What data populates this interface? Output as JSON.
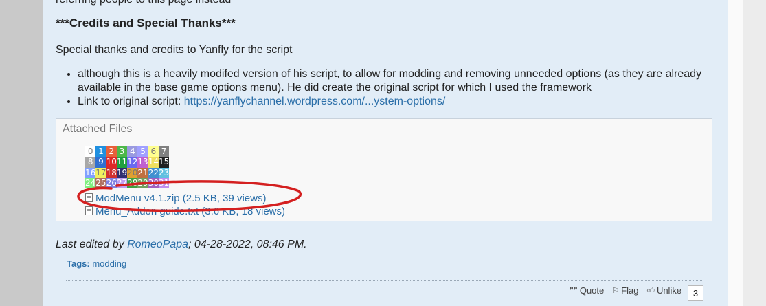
{
  "post": {
    "cut_text": "referring people to this page instead",
    "heading": "***Credits and Special Thanks***",
    "thanks_para": "Special thanks and credits to Yanfly for the script",
    "bullets": [
      {
        "text": "although this is a heavily modifed version of his script, to allow for modding and removing unneeded options (as they are already available in the base game options menu). He did create the original script for which I used the framework"
      },
      {
        "prefix": "Link to original script: ",
        "link": "https://yanflychannel.wordpress.com/...ystem-options/"
      }
    ]
  },
  "attachments": {
    "title": "Attached Files",
    "thumbnail_numbers": [
      "0",
      "1",
      "2",
      "3",
      "4",
      "5",
      "6",
      "7",
      "8",
      "9",
      "10",
      "11",
      "12",
      "13",
      "14",
      "15",
      "16",
      "17",
      "18",
      "19",
      "20",
      "21",
      "22",
      "23",
      "24",
      "25",
      "26",
      "27",
      "28",
      "29",
      "30",
      "31"
    ],
    "thumbnail_colors": [
      "#ffffff",
      "#2090e0",
      "#e8603a",
      "#4db84a",
      "#9a9ae0",
      "#a0a0ff",
      "#ffff90",
      "#808080",
      "#a8a8a8",
      "#3070d0",
      "#e02828",
      "#20a040",
      "#6a6af0",
      "#c060d0",
      "#f0e060",
      "#202020",
      "#80a0ff",
      "#f0f060",
      "#d03030",
      "#303070",
      "#e0a030",
      "#c07040",
      "#4090d0",
      "#60c0e0",
      "#80f080",
      "#b07060",
      "#8080e0",
      "#c0a0f0",
      "#40a040",
      "#70a060",
      "#a060c0",
      "#c090f0"
    ],
    "files": [
      {
        "name": "ModMenu v4.1.zip",
        "meta": "(2.5 KB, 39 views)"
      },
      {
        "name": "Menu_Addon guide.txt",
        "meta": "(3.6 KB, 18 views)"
      }
    ],
    "annotation_color": "#d42020"
  },
  "edit_info": {
    "prefix": "Last edited by ",
    "user": "RomeoPapa",
    "date": "; 04-28-2022, 08:46 PM."
  },
  "tags": {
    "label": "Tags:",
    "items": [
      "modding"
    ]
  },
  "actions": {
    "quote": "Quote",
    "flag": "Flag",
    "unlike": "Unlike",
    "like_count": "3"
  }
}
